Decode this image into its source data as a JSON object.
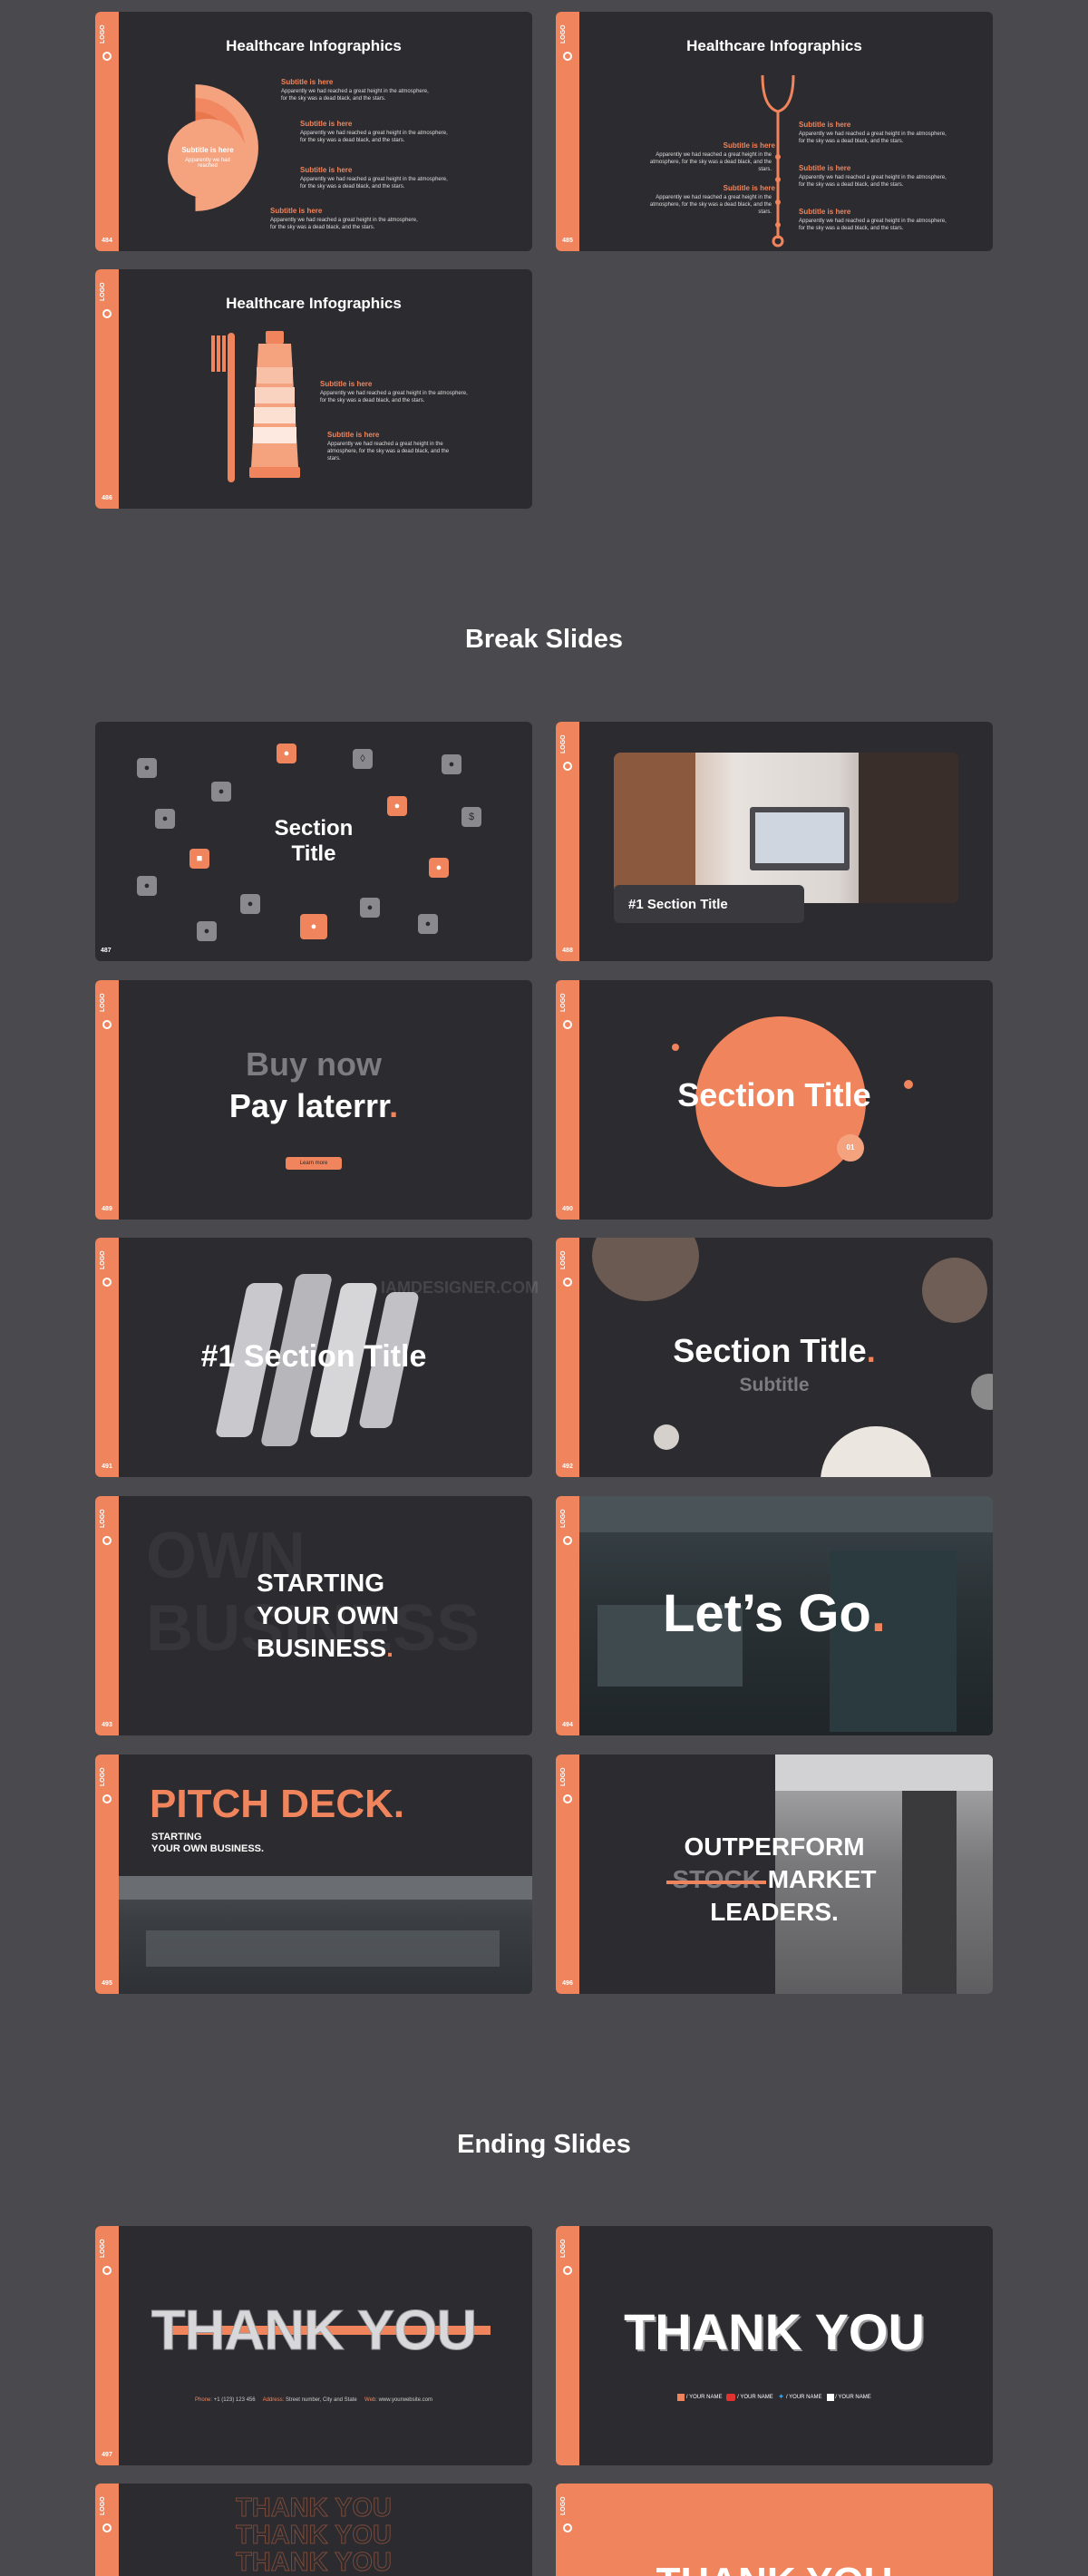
{
  "colors": {
    "accent": "#f0845c",
    "slide_bg": "#2c2b2f",
    "page_bg": "#4a494d"
  },
  "logo_text": "LOGO",
  "page_numbers": {
    "hc1": "484",
    "hc2": "485",
    "hc3": "486",
    "b1": "487",
    "b2": "488",
    "b3": "489",
    "b4": "490",
    "b5": "491",
    "b6": "492",
    "b7": "493",
    "b8": "494",
    "b9": "495",
    "b10": "496",
    "e1": "497"
  },
  "healthcare": {
    "title": "Healthcare Infographics",
    "subtitle_label": "Subtitle is here",
    "body_text": "Apparently we had reached a great height in the atmosphere, for the sky was a dead black, and the stars.",
    "circle_title": "Subtitle is here",
    "circle_text": "Apparently we had reached"
  },
  "sections": {
    "break": "Break Slides",
    "ending": "Ending Slides"
  },
  "break_slides": {
    "s1_title_1": "Section",
    "s1_title_2": "Title",
    "s2_caption": "#1 Section Title",
    "s3_line1": "Buy now",
    "s3_line2": "Pay laterrr",
    "s3_button": "Learn more",
    "s4_title": "Section Title",
    "s4_badge": "01",
    "s5_title": "#1 Section Title",
    "s6_title": "Section Title",
    "s6_subtitle": "Subtitle",
    "s7_line1": "STARTING",
    "s7_line2": "YOUR OWN",
    "s7_line3": "BUSINESS",
    "s7_bg_1": "OWN",
    "s7_bg_2": "BUSINESS",
    "s8_title": "Let’s Go",
    "s9_title": "PITCH DECK.",
    "s9_line1": "STARTING",
    "s9_line2": "YOUR OWN BUSINESS.",
    "s10_line1": "OUTPERFORM",
    "s10_strike": "STOCK",
    "s10_line2": "MARKET",
    "s10_line3": "LEADERS."
  },
  "ending_slides": {
    "thank_you": "THANK YOU",
    "phone_label": "Phone:",
    "phone_value": "+1 (123) 123 456",
    "address_label": "Address:",
    "address_value": "Street number, City and State",
    "web_label": "Web:",
    "web_value": "www.yourwebsite.com",
    "social": [
      "/ YOUR NAME",
      "/ YOUR NAME",
      "/ YOUR NAME",
      "/ YOUR NAME"
    ]
  },
  "watermark": "IAMDESIGNER.COM"
}
